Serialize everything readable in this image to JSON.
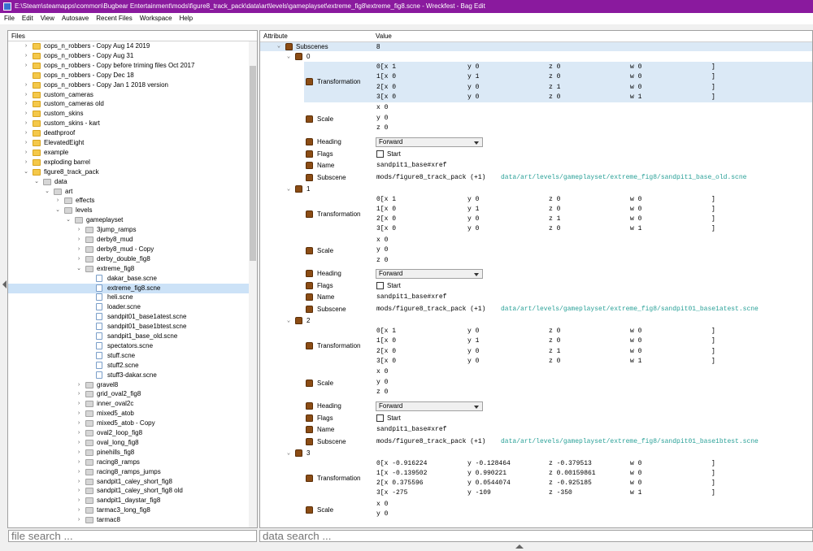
{
  "window": {
    "title": "E:\\Steam\\steamapps\\common\\Bugbear Entertainment\\mods\\figure8_track_pack\\data\\art\\levels\\gameplayset\\extreme_fig8\\extreme_fig8.scne - Wreckfest - Bag Edit"
  },
  "menu": [
    "File",
    "Edit",
    "View",
    "Autosave",
    "Recent Files",
    "Workspace",
    "Help"
  ],
  "files_panel": {
    "header": "Files",
    "search_placeholder": "file search ..."
  },
  "tree": [
    {
      "label": "cops_n_robbers - Copy Aug 14 2019",
      "depth": 1,
      "type": "folder",
      "chev": "right"
    },
    {
      "label": "cops_n_robbers - Copy Aug 31",
      "depth": 1,
      "type": "folder",
      "chev": "right"
    },
    {
      "label": "cops_n_robbers - Copy before triming files Oct 2017",
      "depth": 1,
      "type": "folder",
      "chev": "right"
    },
    {
      "label": "cops_n_robbers - Copy Dec 18",
      "depth": 1,
      "type": "folder",
      "chev": ""
    },
    {
      "label": "cops_n_robbers - Copy Jan 1 2018 version",
      "depth": 1,
      "type": "folder",
      "chev": "right"
    },
    {
      "label": "custom_cameras",
      "depth": 1,
      "type": "folder",
      "chev": "right"
    },
    {
      "label": "custom_cameras old",
      "depth": 1,
      "type": "folder",
      "chev": "right"
    },
    {
      "label": "custom_skins",
      "depth": 1,
      "type": "folder",
      "chev": "right"
    },
    {
      "label": "custom_skins - kart",
      "depth": 1,
      "type": "folder",
      "chev": "right"
    },
    {
      "label": "deathproof",
      "depth": 1,
      "type": "folder",
      "chev": "right"
    },
    {
      "label": "ElevatedEight",
      "depth": 1,
      "type": "folder",
      "chev": "right"
    },
    {
      "label": "example",
      "depth": 1,
      "type": "folder",
      "chev": "right"
    },
    {
      "label": "exploding barrel",
      "depth": 1,
      "type": "folder",
      "chev": "right"
    },
    {
      "label": "figure8_track_pack",
      "depth": 1,
      "type": "folder",
      "chev": "down"
    },
    {
      "label": "data",
      "depth": 2,
      "type": "gfolder",
      "chev": "down"
    },
    {
      "label": "art",
      "depth": 3,
      "type": "gfolder",
      "chev": "down"
    },
    {
      "label": "effects",
      "depth": 4,
      "type": "gfolder",
      "chev": "right"
    },
    {
      "label": "levels",
      "depth": 4,
      "type": "gfolder",
      "chev": "down"
    },
    {
      "label": "gameplayset",
      "depth": 5,
      "type": "gfolder",
      "chev": "down"
    },
    {
      "label": "3jump_ramps",
      "depth": 6,
      "type": "gfolder",
      "chev": "right"
    },
    {
      "label": "derby8_mud",
      "depth": 6,
      "type": "gfolder",
      "chev": "right"
    },
    {
      "label": "derby8_mud - Copy",
      "depth": 6,
      "type": "gfolder",
      "chev": "right"
    },
    {
      "label": "derby_double_fig8",
      "depth": 6,
      "type": "gfolder",
      "chev": "right"
    },
    {
      "label": "extreme_fig8",
      "depth": 6,
      "type": "gfolder",
      "chev": "down"
    },
    {
      "label": "dakar_base.scne",
      "depth": 7,
      "type": "file",
      "chev": ""
    },
    {
      "label": "extreme_fig8.scne",
      "depth": 7,
      "type": "file",
      "chev": "",
      "selected": true
    },
    {
      "label": "heli.scne",
      "depth": 7,
      "type": "file",
      "chev": ""
    },
    {
      "label": "loader.scne",
      "depth": 7,
      "type": "file",
      "chev": ""
    },
    {
      "label": "sandpit01_base1atest.scne",
      "depth": 7,
      "type": "file",
      "chev": ""
    },
    {
      "label": "sandpit01_base1btest.scne",
      "depth": 7,
      "type": "file",
      "chev": ""
    },
    {
      "label": "sandpit1_base_old.scne",
      "depth": 7,
      "type": "file",
      "chev": ""
    },
    {
      "label": "spectators.scne",
      "depth": 7,
      "type": "file",
      "chev": ""
    },
    {
      "label": "stuff.scne",
      "depth": 7,
      "type": "file",
      "chev": ""
    },
    {
      "label": "stuff2.scne",
      "depth": 7,
      "type": "file",
      "chev": ""
    },
    {
      "label": "stuff3-dakar.scne",
      "depth": 7,
      "type": "file",
      "chev": ""
    },
    {
      "label": "gravel8",
      "depth": 6,
      "type": "gfolder",
      "chev": "right"
    },
    {
      "label": "grid_oval2_fig8",
      "depth": 6,
      "type": "gfolder",
      "chev": "right"
    },
    {
      "label": "inner_oval2c",
      "depth": 6,
      "type": "gfolder",
      "chev": "right"
    },
    {
      "label": "mixed5_atob",
      "depth": 6,
      "type": "gfolder",
      "chev": "right"
    },
    {
      "label": "mixed5_atob - Copy",
      "depth": 6,
      "type": "gfolder",
      "chev": "right"
    },
    {
      "label": "oval2_loop_fig8",
      "depth": 6,
      "type": "gfolder",
      "chev": "right"
    },
    {
      "label": "oval_long_fig8",
      "depth": 6,
      "type": "gfolder",
      "chev": "right"
    },
    {
      "label": "pinehills_fig8",
      "depth": 6,
      "type": "gfolder",
      "chev": "right"
    },
    {
      "label": "racing8_ramps",
      "depth": 6,
      "type": "gfolder",
      "chev": "right"
    },
    {
      "label": "racing8_ramps_jumps",
      "depth": 6,
      "type": "gfolder",
      "chev": "right"
    },
    {
      "label": "sandpit1_caley_short_fig8",
      "depth": 6,
      "type": "gfolder",
      "chev": "right"
    },
    {
      "label": "sandpit1_caley_short_fig8 old",
      "depth": 6,
      "type": "gfolder",
      "chev": "right"
    },
    {
      "label": "sandpit1_daystar_fig8",
      "depth": 6,
      "type": "gfolder",
      "chev": "right"
    },
    {
      "label": "tarmac3_long_fig8",
      "depth": 6,
      "type": "gfolder",
      "chev": "right"
    },
    {
      "label": "tarmac8",
      "depth": 6,
      "type": "gfolder",
      "chev": "right"
    }
  ],
  "data_panel": {
    "col_attribute": "Attribute",
    "col_value": "Value",
    "search_placeholder": "data search ..."
  },
  "subscenes": {
    "label": "Subscenes",
    "count": "8"
  },
  "labels": {
    "transformation": "Transformation",
    "scale": "Scale",
    "heading": "Heading",
    "flags": "Flags",
    "name": "Name",
    "subscene": "Subscene",
    "start": "Start"
  },
  "entries": [
    {
      "index": "0",
      "matrix": [
        [
          "0[x 1",
          "y 0",
          "z 0",
          "w 0",
          "]"
        ],
        [
          "1[x 0",
          "y 1",
          "z 0",
          "w 0",
          "]"
        ],
        [
          "2[x 0",
          "y 0",
          "z 1",
          "w 0",
          "]"
        ],
        [
          "3[x 0",
          "y 0",
          "z 0",
          "w 1",
          "]"
        ]
      ],
      "scale": [
        "x 0",
        "y 0",
        "z 0"
      ],
      "heading": "Forward",
      "name": "sandpit1_base#xref",
      "sub_prefix": "mods/figure8_track_pack (+1)",
      "sub_path": "data/art/levels/gameplayset/extreme_fig8/sandpit1_base_old.scne"
    },
    {
      "index": "1",
      "matrix": [
        [
          "0[x 1",
          "y 0",
          "z 0",
          "w 0",
          "]"
        ],
        [
          "1[x 0",
          "y 1",
          "z 0",
          "w 0",
          "]"
        ],
        [
          "2[x 0",
          "y 0",
          "z 1",
          "w 0",
          "]"
        ],
        [
          "3[x 0",
          "y 0",
          "z 0",
          "w 1",
          "]"
        ]
      ],
      "scale": [
        "x 0",
        "y 0",
        "z 0"
      ],
      "heading": "Forward",
      "name": "sandpit1_base#xref",
      "sub_prefix": "mods/figure8_track_pack (+1)",
      "sub_path": "data/art/levels/gameplayset/extreme_fig8/sandpit01_base1atest.scne"
    },
    {
      "index": "2",
      "matrix": [
        [
          "0[x 1",
          "y 0",
          "z 0",
          "w 0",
          "]"
        ],
        [
          "1[x 0",
          "y 1",
          "z 0",
          "w 0",
          "]"
        ],
        [
          "2[x 0",
          "y 0",
          "z 1",
          "w 0",
          "]"
        ],
        [
          "3[x 0",
          "y 0",
          "z 0",
          "w 1",
          "]"
        ]
      ],
      "scale": [
        "x 0",
        "y 0",
        "z 0"
      ],
      "heading": "Forward",
      "name": "sandpit1_base#xref",
      "sub_prefix": "mods/figure8_track_pack (+1)",
      "sub_path": "data/art/levels/gameplayset/extreme_fig8/sandpit01_base1btest.scne"
    },
    {
      "index": "3",
      "matrix": [
        [
          "0[x -0.916224",
          "y -0.128464",
          "z -0.379513",
          "w 0",
          "]"
        ],
        [
          "1[x -0.139502",
          "y 0.990221",
          "z 0.00159861",
          "w 0",
          "]"
        ],
        [
          "2[x 0.375596",
          "y 0.0544074",
          "z -0.925185",
          "w 0",
          "]"
        ],
        [
          "3[x -275",
          "y -109",
          "z -350",
          "w 1",
          "]"
        ]
      ],
      "scale": [
        "x 0",
        "y 0"
      ]
    }
  ]
}
